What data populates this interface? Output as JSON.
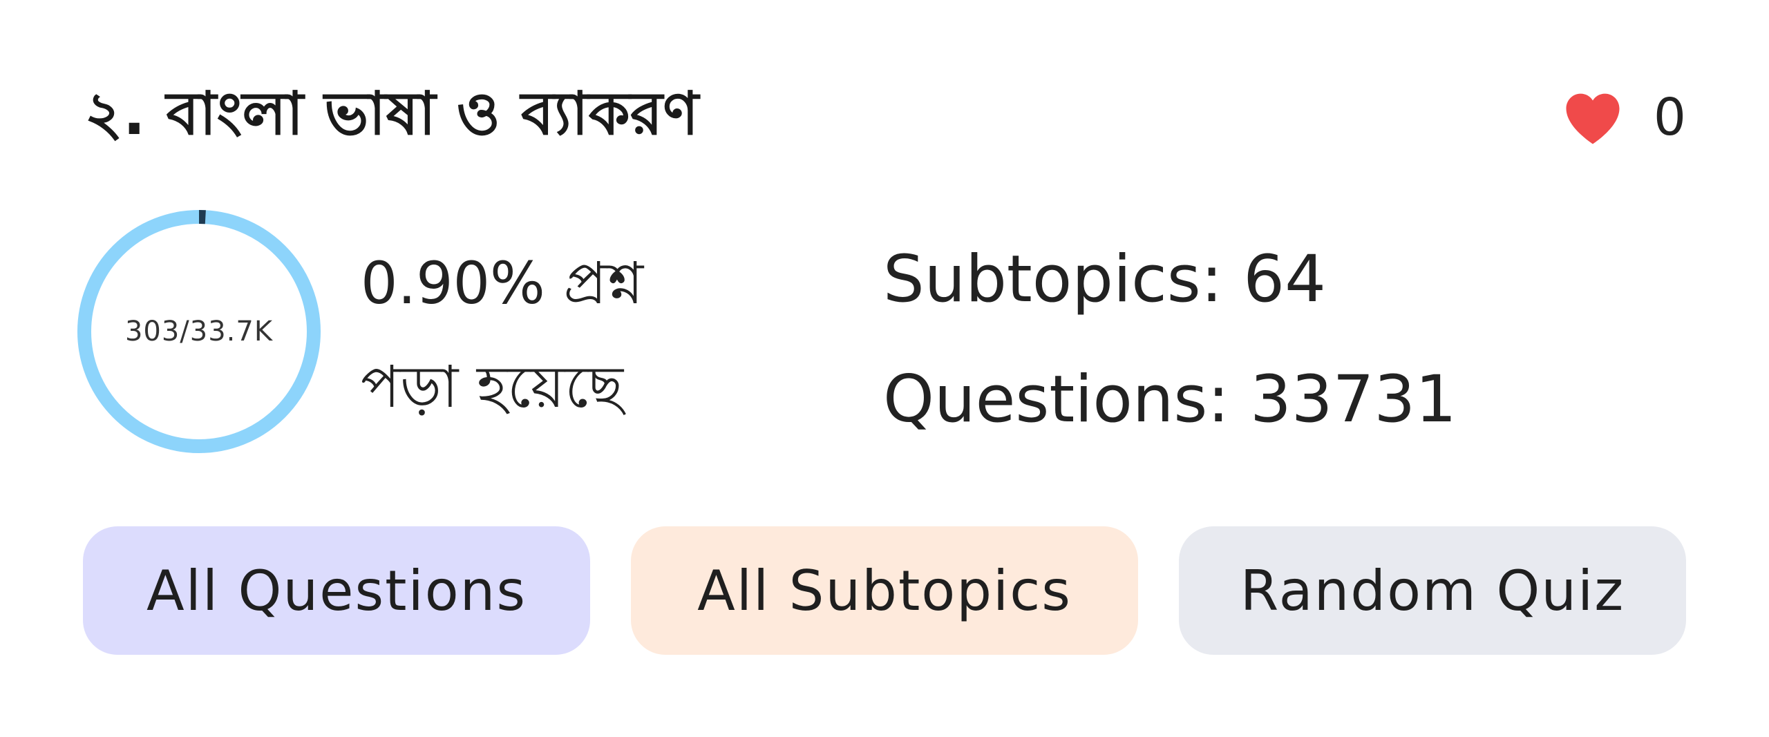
{
  "topic": {
    "title": "২. বাংলা ভাষা ও ব্যাকরণ"
  },
  "likes": {
    "count": "0",
    "icon": "heart-icon",
    "color": "#f04a4a"
  },
  "progress": {
    "label": "303/33.7K",
    "read": 303,
    "total": 33731,
    "fraction": 0.009,
    "ring_color": "#8dd4fb",
    "progress_color": "#1f3b52",
    "read_line1": "0.90% প্রশ্ন",
    "read_line2": "পড়া হয়েছে"
  },
  "stats": {
    "subtopics": "Subtopics: 64",
    "questions": "Questions: 33731"
  },
  "buttons": {
    "all_questions": "All Questions",
    "all_subtopics": "All Subtopics",
    "random_quiz": "Random Quiz"
  }
}
